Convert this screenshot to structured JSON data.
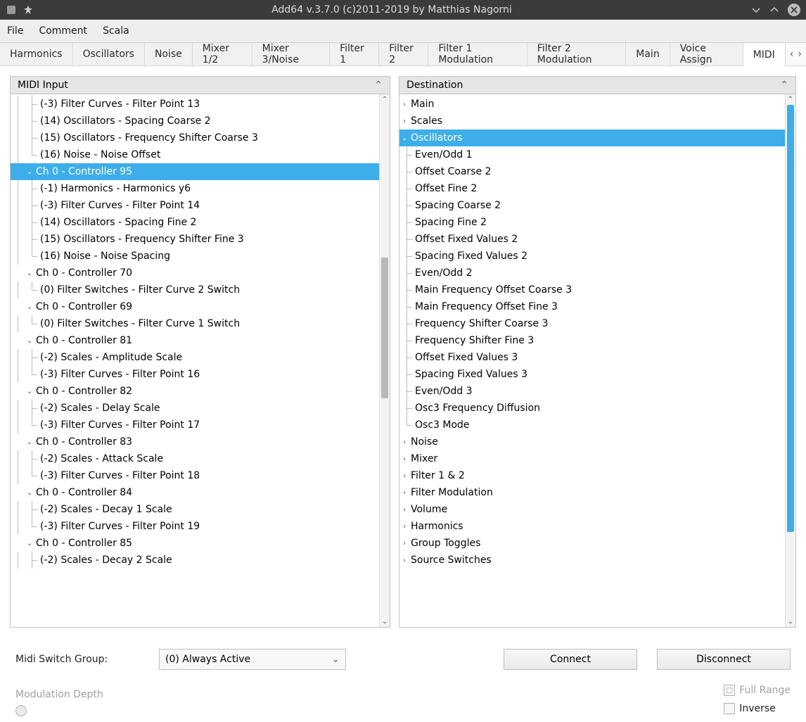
{
  "window": {
    "title": "Add64  v.3.7.0   (c)2011-2019 by Matthias Nagorni"
  },
  "menu": {
    "items": [
      "File",
      "Comment",
      "Scala"
    ]
  },
  "tabs": [
    "Harmonics",
    "Oscillators",
    "Noise",
    "Mixer 1/2",
    "Mixer 3/Noise",
    "Filter 1",
    "Filter 2",
    "Filter 1 Modulation",
    "Filter 2 Modulation",
    "Main",
    "Voice Assign",
    "MIDI"
  ],
  "active_tab": "MIDI",
  "midi_input": {
    "header": "MIDI Input",
    "tree": [
      {
        "indent": 2,
        "branch": "mid",
        "label": "(-3) Filter Curves - Filter Point 13"
      },
      {
        "indent": 2,
        "branch": "mid",
        "label": "(14) Oscillators - Spacing Coarse 2"
      },
      {
        "indent": 2,
        "branch": "mid",
        "label": "(15) Oscillators - Frequency Shifter Coarse 3"
      },
      {
        "indent": 2,
        "branch": "end",
        "label": "(16) Noise - Noise Offset"
      },
      {
        "indent": 1,
        "tog": "v",
        "label": "Ch 0 - Controller 95",
        "selected": true
      },
      {
        "indent": 2,
        "branch": "mid",
        "label": "(-1) Harmonics - Harmonics y6"
      },
      {
        "indent": 2,
        "branch": "mid",
        "label": "(-3) Filter Curves - Filter Point 14"
      },
      {
        "indent": 2,
        "branch": "mid",
        "label": "(14) Oscillators - Spacing Fine 2"
      },
      {
        "indent": 2,
        "branch": "mid",
        "label": "(15) Oscillators - Frequency Shifter Fine 3"
      },
      {
        "indent": 2,
        "branch": "end",
        "label": "(16) Noise - Noise Spacing"
      },
      {
        "indent": 1,
        "tog": "v",
        "label": "Ch 0 - Controller 70"
      },
      {
        "indent": 2,
        "branch": "end",
        "label": "(0) Filter Switches - Filter Curve 2  Switch"
      },
      {
        "indent": 1,
        "tog": "v",
        "label": "Ch 0 - Controller 69"
      },
      {
        "indent": 2,
        "branch": "end",
        "label": "(0) Filter Switches - Filter Curve 1  Switch"
      },
      {
        "indent": 1,
        "tog": "v",
        "label": "Ch 0 - Controller 81"
      },
      {
        "indent": 2,
        "branch": "mid",
        "label": "(-2) Scales - Amplitude Scale"
      },
      {
        "indent": 2,
        "branch": "end",
        "label": "(-3) Filter Curves - Filter Point 16"
      },
      {
        "indent": 1,
        "tog": "v",
        "label": "Ch 0 - Controller 82"
      },
      {
        "indent": 2,
        "branch": "mid",
        "label": "(-2) Scales - Delay Scale"
      },
      {
        "indent": 2,
        "branch": "end",
        "label": "(-3) Filter Curves - Filter Point 17"
      },
      {
        "indent": 1,
        "tog": "v",
        "label": "Ch 0 - Controller 83"
      },
      {
        "indent": 2,
        "branch": "mid",
        "label": "(-2) Scales - Attack Scale"
      },
      {
        "indent": 2,
        "branch": "end",
        "label": "(-3) Filter Curves - Filter Point 18"
      },
      {
        "indent": 1,
        "tog": "v",
        "label": "Ch 0 - Controller 84"
      },
      {
        "indent": 2,
        "branch": "mid",
        "label": "(-2) Scales - Decay 1 Scale"
      },
      {
        "indent": 2,
        "branch": "end",
        "label": "(-3) Filter Curves - Filter Point 19"
      },
      {
        "indent": 1,
        "tog": "v",
        "label": "Ch 0 - Controller 85"
      },
      {
        "indent": 2,
        "branch": "mid",
        "label": "(-2) Scales - Decay 2 Scale"
      }
    ]
  },
  "destination": {
    "header": "Destination",
    "tree": [
      {
        "indent": 0,
        "tog": ">",
        "label": "Main"
      },
      {
        "indent": 0,
        "tog": ">",
        "label": "Scales"
      },
      {
        "indent": 0,
        "tog": "v",
        "label": "Oscillators",
        "selected": true
      },
      {
        "indent": 1,
        "branch": "mid",
        "label": "Even/Odd 1"
      },
      {
        "indent": 1,
        "branch": "mid",
        "label": "Offset Coarse 2"
      },
      {
        "indent": 1,
        "branch": "mid",
        "label": "Offset Fine 2"
      },
      {
        "indent": 1,
        "branch": "mid",
        "label": "Spacing Coarse 2"
      },
      {
        "indent": 1,
        "branch": "mid",
        "label": "Spacing Fine 2"
      },
      {
        "indent": 1,
        "branch": "mid",
        "label": "Offset Fixed Values 2"
      },
      {
        "indent": 1,
        "branch": "mid",
        "label": "Spacing Fixed Values 2"
      },
      {
        "indent": 1,
        "branch": "mid",
        "label": "Even/Odd 2"
      },
      {
        "indent": 1,
        "branch": "mid",
        "label": "Main Frequency Offset Coarse 3"
      },
      {
        "indent": 1,
        "branch": "mid",
        "label": "Main Frequency Offset Fine 3"
      },
      {
        "indent": 1,
        "branch": "mid",
        "label": "Frequency Shifter Coarse 3"
      },
      {
        "indent": 1,
        "branch": "mid",
        "label": "Frequency Shifter Fine 3"
      },
      {
        "indent": 1,
        "branch": "mid",
        "label": "Offset Fixed Values 3"
      },
      {
        "indent": 1,
        "branch": "mid",
        "label": "Spacing Fixed Values 3"
      },
      {
        "indent": 1,
        "branch": "mid",
        "label": "Even/Odd 3"
      },
      {
        "indent": 1,
        "branch": "mid",
        "label": "Osc3 Frequency Diffusion"
      },
      {
        "indent": 1,
        "branch": "end",
        "label": "Osc3 Mode"
      },
      {
        "indent": 0,
        "tog": ">",
        "label": "Noise"
      },
      {
        "indent": 0,
        "tog": ">",
        "label": "Mixer"
      },
      {
        "indent": 0,
        "tog": ">",
        "label": "Filter 1 & 2"
      },
      {
        "indent": 0,
        "tog": ">",
        "label": "Filter Modulation"
      },
      {
        "indent": 0,
        "tog": ">",
        "label": "Volume"
      },
      {
        "indent": 0,
        "tog": ">",
        "label": "Harmonics"
      },
      {
        "indent": 0,
        "tog": ">",
        "label": "Group Toggles"
      },
      {
        "indent": 0,
        "tog": ">",
        "label": "Source Switches"
      }
    ]
  },
  "footer": {
    "switch_label": "Midi Switch Group:",
    "switch_value": "(0) Always Active",
    "connect": "Connect",
    "disconnect": "Disconnect",
    "mod_depth": "Modulation Depth",
    "full_range": "Full Range",
    "inverse": "Inverse"
  }
}
